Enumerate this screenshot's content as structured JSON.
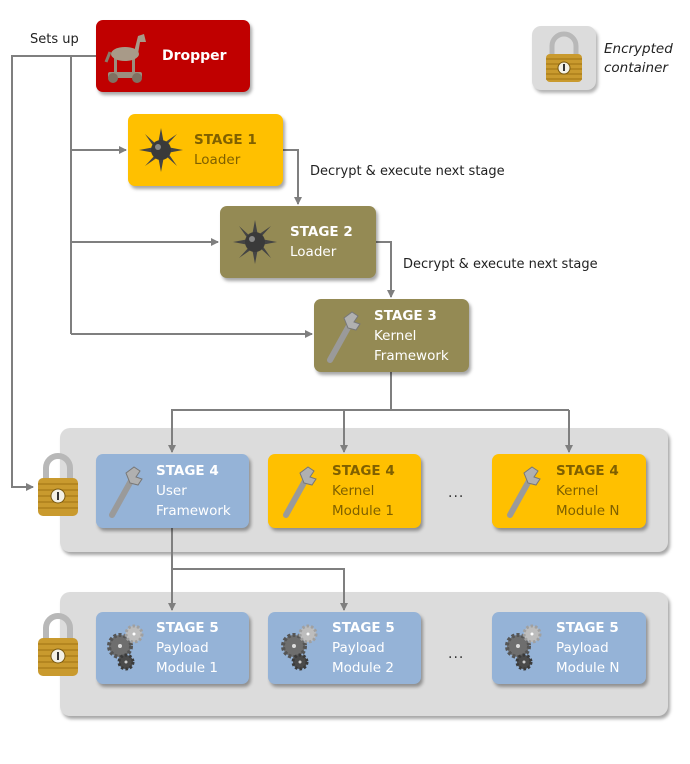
{
  "legend": {
    "icon": "padlock-icon",
    "text_line1": "Encrypted",
    "text_line2": "container"
  },
  "annotations": {
    "sets_up": "Sets up",
    "decrypt1": "Decrypt & execute next stage",
    "decrypt2": "Decrypt & execute next stage"
  },
  "colors": {
    "dropper": "#c00000",
    "yellow": "#ffc000",
    "olive": "#948a54",
    "blue": "#95b3d7",
    "group": "#dcdcdc",
    "line": "#7f7f7f"
  },
  "nodes": {
    "dropper": {
      "icon": "trojan-horse-icon",
      "title": "Dropper"
    },
    "stage1": {
      "icon": "spiked-mine-icon",
      "title": "STAGE 1",
      "line1": "Loader"
    },
    "stage2": {
      "icon": "spiked-mine-icon",
      "title": "STAGE 2",
      "line1": "Loader"
    },
    "stage3": {
      "icon": "wrench-icon",
      "title": "STAGE 3",
      "line1": "Kernel",
      "line2": "Framework"
    },
    "stage4_user": {
      "icon": "wrench-icon",
      "title": "STAGE 4",
      "line1": "User",
      "line2": "Framework"
    },
    "stage4_k1": {
      "icon": "wrench-icon",
      "title": "STAGE 4",
      "line1": "Kernel",
      "line2": "Module 1"
    },
    "stage4_kn": {
      "icon": "wrench-icon",
      "title": "STAGE 4",
      "line1": "Kernel",
      "line2": "Module N"
    },
    "stage5_p1": {
      "icon": "gears-icon",
      "title": "STAGE 5",
      "line1": "Payload",
      "line2": "Module 1"
    },
    "stage5_p2": {
      "icon": "gears-icon",
      "title": "STAGE 5",
      "line1": "Payload",
      "line2": "Module 2"
    },
    "stage5_pn": {
      "icon": "gears-icon",
      "title": "STAGE 5",
      "line1": "Payload",
      "line2": "Module N"
    }
  },
  "ellipsis": "..."
}
